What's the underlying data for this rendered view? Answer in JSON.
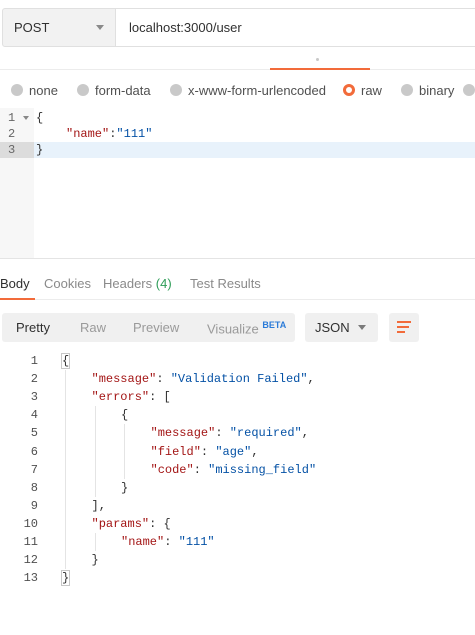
{
  "request": {
    "method": "POST",
    "url": "localhost:3000/user"
  },
  "body_types": [
    {
      "label": "none",
      "selected": false
    },
    {
      "label": "form-data",
      "selected": false
    },
    {
      "label": "x-www-form-urlencoded",
      "selected": false
    },
    {
      "label": "raw",
      "selected": true
    },
    {
      "label": "binary",
      "selected": false
    }
  ],
  "request_body": [
    {
      "num": "1",
      "text": "{"
    },
    {
      "num": "2",
      "key": "\"name\"",
      "value": "\"111\""
    },
    {
      "num": "3",
      "text": "}"
    }
  ],
  "response_tabs": [
    {
      "label": "Body",
      "active": true
    },
    {
      "label": "Cookies",
      "active": false
    },
    {
      "label": "Headers",
      "count": "(4)",
      "active": false
    },
    {
      "label": "Test Results",
      "active": false
    }
  ],
  "view_modes": {
    "pretty": "Pretty",
    "raw": "Raw",
    "preview": "Preview",
    "visualize": "Visualize",
    "beta": "BETA"
  },
  "format": "JSON",
  "response_body": [
    {
      "num": "1",
      "indent": 0,
      "parts": [
        [
          "p",
          "{"
        ]
      ]
    },
    {
      "num": "2",
      "indent": 1,
      "parts": [
        [
          "k",
          "\"message\""
        ],
        [
          "p",
          ": "
        ],
        [
          "v",
          "\"Validation Failed\""
        ],
        [
          "p",
          ","
        ]
      ]
    },
    {
      "num": "3",
      "indent": 1,
      "parts": [
        [
          "k",
          "\"errors\""
        ],
        [
          "p",
          ": ["
        ]
      ]
    },
    {
      "num": "4",
      "indent": 2,
      "parts": [
        [
          "p",
          "{"
        ]
      ]
    },
    {
      "num": "5",
      "indent": 3,
      "parts": [
        [
          "k",
          "\"message\""
        ],
        [
          "p",
          ": "
        ],
        [
          "v",
          "\"required\""
        ],
        [
          "p",
          ","
        ]
      ]
    },
    {
      "num": "6",
      "indent": 3,
      "parts": [
        [
          "k",
          "\"field\""
        ],
        [
          "p",
          ": "
        ],
        [
          "v",
          "\"age\""
        ],
        [
          "p",
          ","
        ]
      ]
    },
    {
      "num": "7",
      "indent": 3,
      "parts": [
        [
          "k",
          "\"code\""
        ],
        [
          "p",
          ": "
        ],
        [
          "v",
          "\"missing_field\""
        ]
      ]
    },
    {
      "num": "8",
      "indent": 2,
      "parts": [
        [
          "p",
          "}"
        ]
      ]
    },
    {
      "num": "9",
      "indent": 1,
      "parts": [
        [
          "p",
          "],"
        ]
      ]
    },
    {
      "num": "10",
      "indent": 1,
      "parts": [
        [
          "k",
          "\"params\""
        ],
        [
          "p",
          ": {"
        ]
      ]
    },
    {
      "num": "11",
      "indent": 2,
      "parts": [
        [
          "k",
          "\"name\""
        ],
        [
          "p",
          ": "
        ],
        [
          "v",
          "\"111\""
        ]
      ]
    },
    {
      "num": "12",
      "indent": 1,
      "parts": [
        [
          "p",
          "}"
        ]
      ]
    },
    {
      "num": "13",
      "indent": 0,
      "parts": [
        [
          "p",
          "}"
        ]
      ]
    }
  ],
  "colors": {
    "accent": "#f26b3a",
    "json_key": "#a31515",
    "json_value": "#0451a5",
    "count_green": "#2e9d58",
    "beta_blue": "#2b7bd8"
  }
}
